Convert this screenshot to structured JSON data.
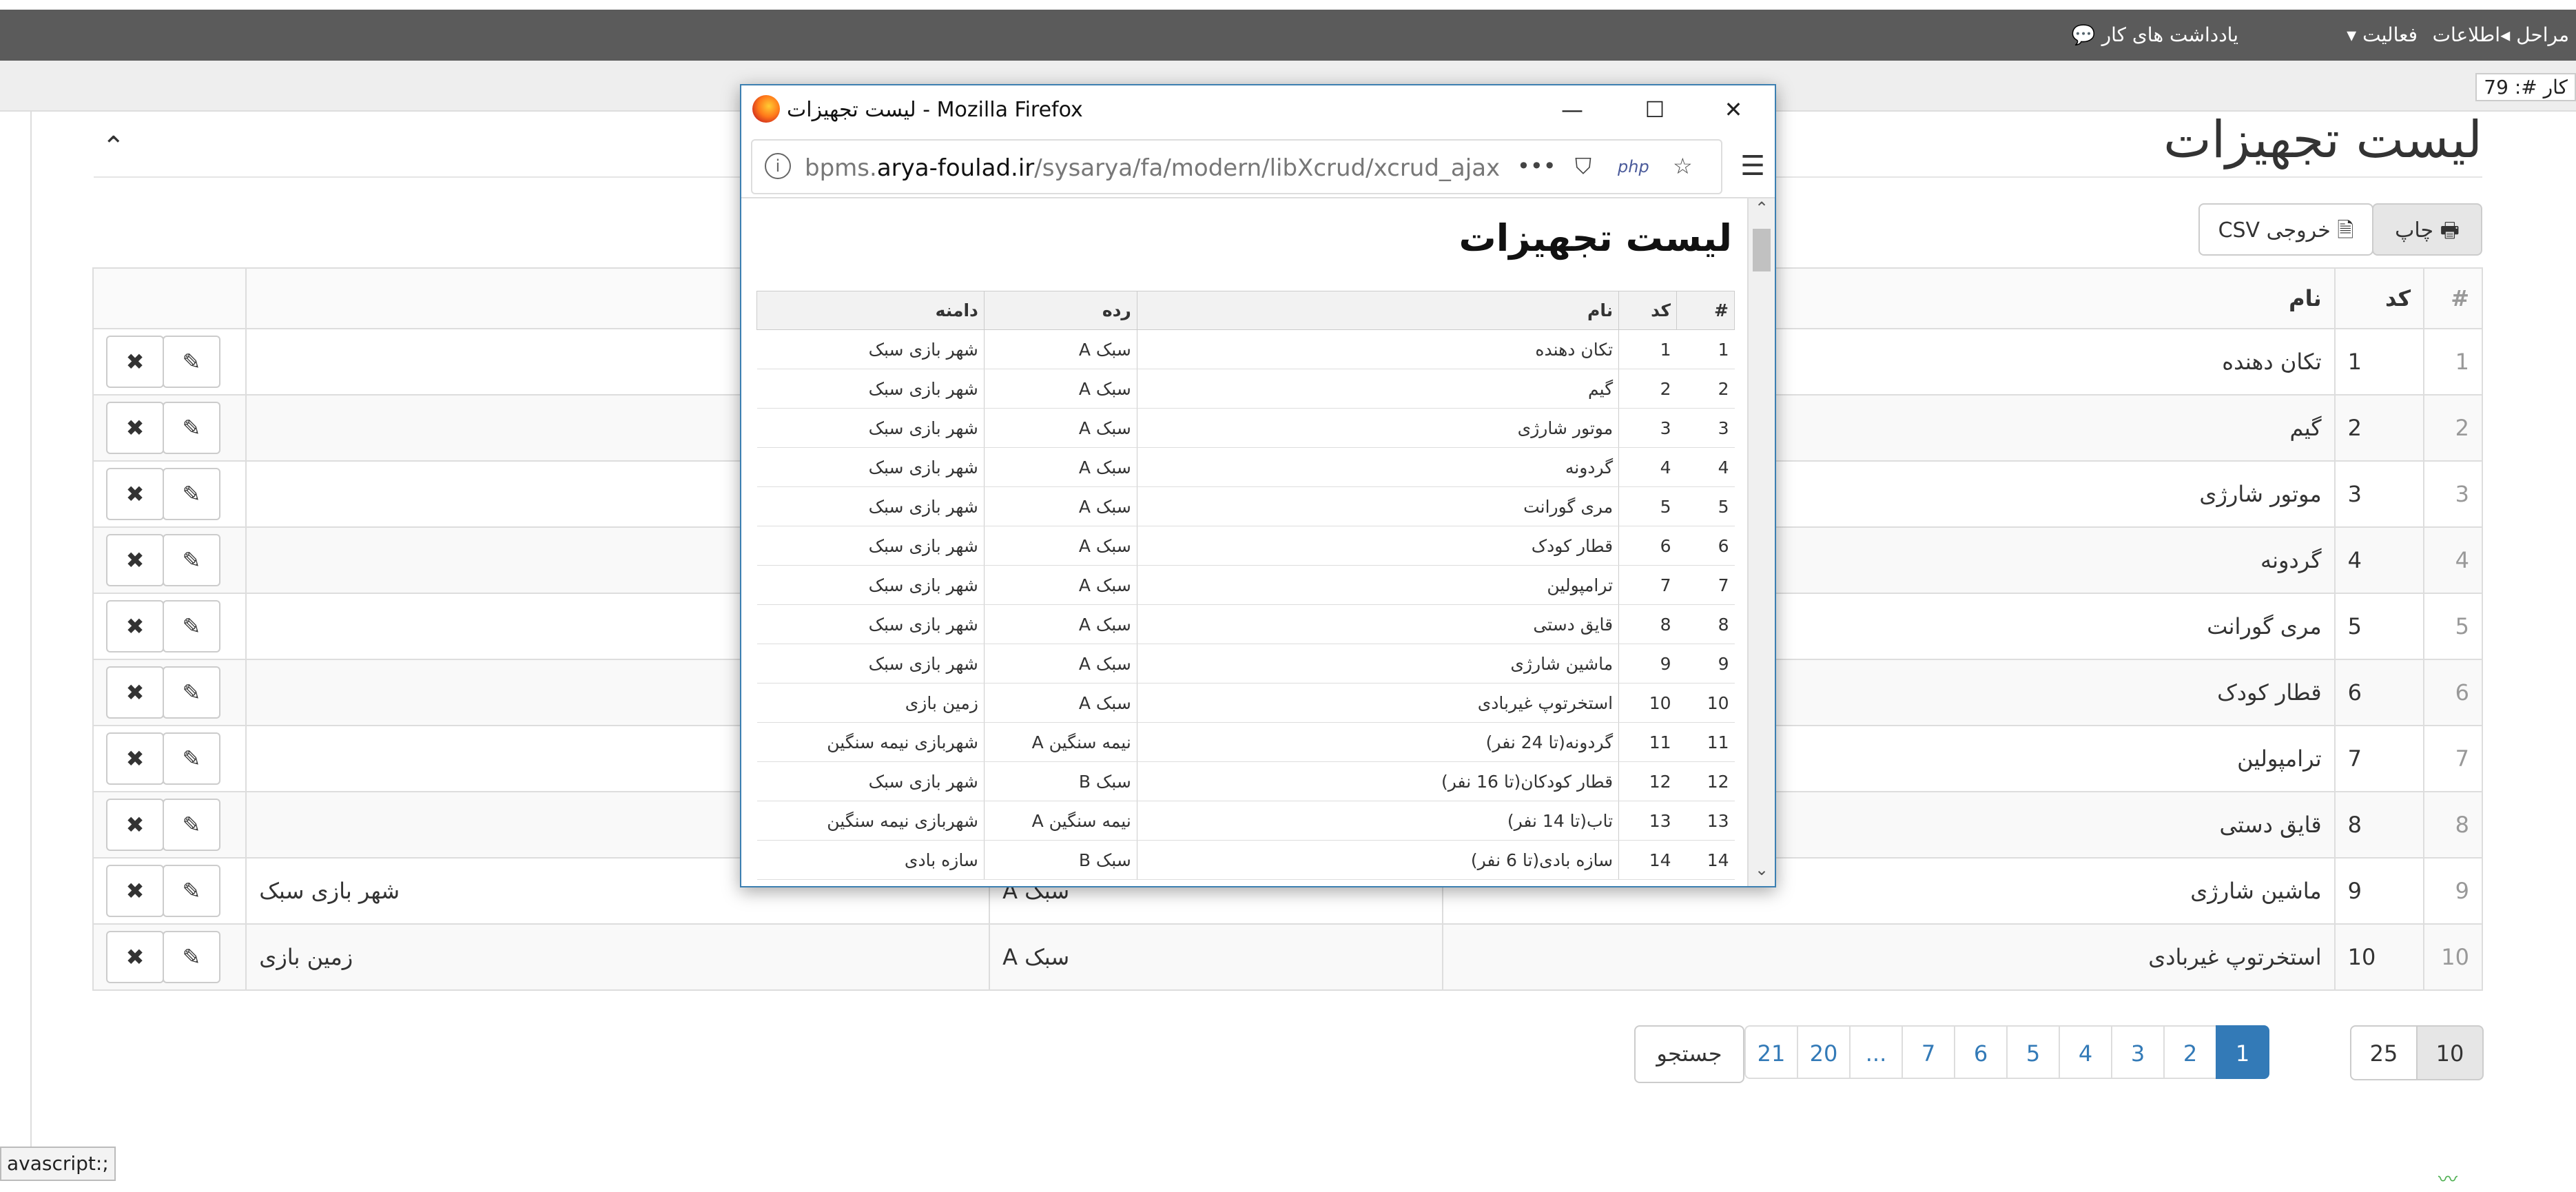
{
  "topbar": {
    "menu_marahel": "مراحل",
    "menu_ettelaat": "اطلاعات",
    "menu_faaliat": "فعالیت",
    "menu_notes": "یادداشت های کار"
  },
  "subbar": {
    "tab_label": "کار #: 79"
  },
  "page": {
    "title": "لیست تجهیزات",
    "print_label": "چاپ",
    "csv_label": "خروجی CSV",
    "columns": {
      "hash": "#",
      "code": "کد",
      "name": "نام"
    },
    "rows": [
      {
        "hash": "1",
        "code": "1",
        "name": "تکان دهنده",
        "grade": "",
        "domain": ""
      },
      {
        "hash": "2",
        "code": "2",
        "name": "گیم",
        "grade": "",
        "domain": ""
      },
      {
        "hash": "3",
        "code": "3",
        "name": "موتور شارژی",
        "grade": "",
        "domain": ""
      },
      {
        "hash": "4",
        "code": "4",
        "name": "گردونه",
        "grade": "",
        "domain": ""
      },
      {
        "hash": "5",
        "code": "5",
        "name": "مری گورانت",
        "grade": "",
        "domain": ""
      },
      {
        "hash": "6",
        "code": "6",
        "name": "قطار کودک",
        "grade": "",
        "domain": ""
      },
      {
        "hash": "7",
        "code": "7",
        "name": "ترامپولین",
        "grade": "",
        "domain": ""
      },
      {
        "hash": "8",
        "code": "8",
        "name": "قایق دستی",
        "grade": "",
        "domain": ""
      },
      {
        "hash": "9",
        "code": "9",
        "name": "ماشین شارژی",
        "grade": "سبک A",
        "domain": "شهر بازی سبک"
      },
      {
        "hash": "10",
        "code": "10",
        "name": "استخرتوپ غیربادی",
        "grade": "سبک A",
        "domain": "زمین بازی"
      }
    ],
    "pagination": [
      "21",
      "20",
      "...",
      "7",
      "6",
      "5",
      "4",
      "3",
      "2",
      "1"
    ],
    "active_page": "1",
    "search_label": "جستجو",
    "page_sizes": [
      "25",
      "10"
    ],
    "selected_page_size": "10"
  },
  "statusbar": {
    "text": "avascript:;"
  },
  "popup": {
    "window_title": "لیست تجهیزات - Mozilla Firefox",
    "url_prefix": "bpms.",
    "url_domain": "arya-foulad.ir",
    "url_path": "/sysarya/fa/modern/libXcrud/xcrud_ajax",
    "php_badge": "php",
    "heading": "لیست تجهیزات",
    "columns": {
      "hash": "#",
      "code": "کد",
      "name": "نام",
      "grade": "رده",
      "domain": "دامنه"
    },
    "rows": [
      {
        "hash": "1",
        "code": "1",
        "name": "تکان دهنده",
        "grade": "سبک A",
        "domain": "شهر بازی سبک"
      },
      {
        "hash": "2",
        "code": "2",
        "name": "گیم",
        "grade": "سبک A",
        "domain": "شهر بازی سبک"
      },
      {
        "hash": "3",
        "code": "3",
        "name": "موتور شارژی",
        "grade": "سبک A",
        "domain": "شهر بازی سبک"
      },
      {
        "hash": "4",
        "code": "4",
        "name": "گردونه",
        "grade": "سبک A",
        "domain": "شهر بازی سبک"
      },
      {
        "hash": "5",
        "code": "5",
        "name": "مری گورانت",
        "grade": "سبک A",
        "domain": "شهر بازی سبک"
      },
      {
        "hash": "6",
        "code": "6",
        "name": "قطار کودک",
        "grade": "سبک A",
        "domain": "شهر بازی سبک"
      },
      {
        "hash": "7",
        "code": "7",
        "name": "ترامپولین",
        "grade": "سبک A",
        "domain": "شهر بازی سبک"
      },
      {
        "hash": "8",
        "code": "8",
        "name": "قایق دستی",
        "grade": "سبک A",
        "domain": "شهر بازی سبک"
      },
      {
        "hash": "9",
        "code": "9",
        "name": "ماشین شارژی",
        "grade": "سبک A",
        "domain": "شهر بازی سبک"
      },
      {
        "hash": "10",
        "code": "10",
        "name": "استخرتوپ غیربادی",
        "grade": "سبک A",
        "domain": "زمین بازی"
      },
      {
        "hash": "11",
        "code": "11",
        "name": "گردونه(تا 24 نفر)",
        "grade": "نیمه سنگین A",
        "domain": "شهربازی نیمه سنگین"
      },
      {
        "hash": "12",
        "code": "12",
        "name": "قطار کودکان(تا 16 نفر)",
        "grade": "سبک B",
        "domain": "شهر بازی سبک"
      },
      {
        "hash": "13",
        "code": "13",
        "name": "تاب(تا 14 نفر)",
        "grade": "نیمه سنگین A",
        "domain": "شهربازی نیمه سنگین"
      },
      {
        "hash": "14",
        "code": "14",
        "name": "سازه بادی(تا 6 نفر)",
        "grade": "سبک B",
        "domain": "سازه بادی"
      }
    ]
  },
  "colors": {
    "primary": "#337ab7",
    "topbar": "#5b5b5b",
    "window_border": "#3c7fb1"
  }
}
